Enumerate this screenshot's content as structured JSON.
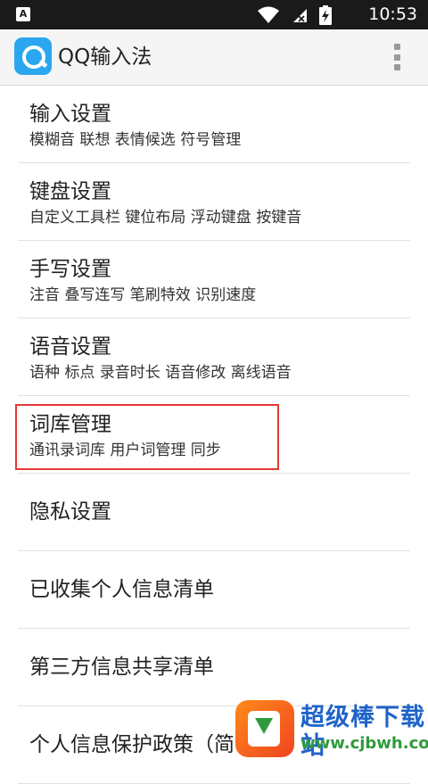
{
  "status_bar": {
    "notification_glyph": "A",
    "time": "10:53"
  },
  "app_bar": {
    "title": "QQ输入法"
  },
  "settings": [
    {
      "title": "输入设置",
      "subtitle": "模糊音 联想 表情候选 符号管理"
    },
    {
      "title": "键盘设置",
      "subtitle": "自定义工具栏 键位布局 浮动键盘 按键音"
    },
    {
      "title": "手写设置",
      "subtitle": "注音 叠写连写 笔刷特效 识别速度"
    },
    {
      "title": "语音设置",
      "subtitle": "语种 标点 录音时长 语音修改 离线语音"
    },
    {
      "title": "词库管理",
      "subtitle": "通讯录词库 用户词管理 同步"
    },
    {
      "title": "隐私设置"
    },
    {
      "title": "已收集个人信息清单"
    },
    {
      "title": "第三方信息共享清单"
    },
    {
      "title": "个人信息保护政策（简"
    }
  ],
  "watermark": {
    "name": "超级棒下载站",
    "url": "www.cjbwh.com"
  },
  "colors": {
    "accent": "#2aa7ee",
    "highlight_border": "#e53935",
    "status_bar": "#1a1a1a"
  },
  "icons": [
    "notification-a-icon",
    "wifi-icon",
    "no-sim-icon",
    "battery-charging-icon",
    "app-logo-icon",
    "overflow-menu-icon"
  ]
}
